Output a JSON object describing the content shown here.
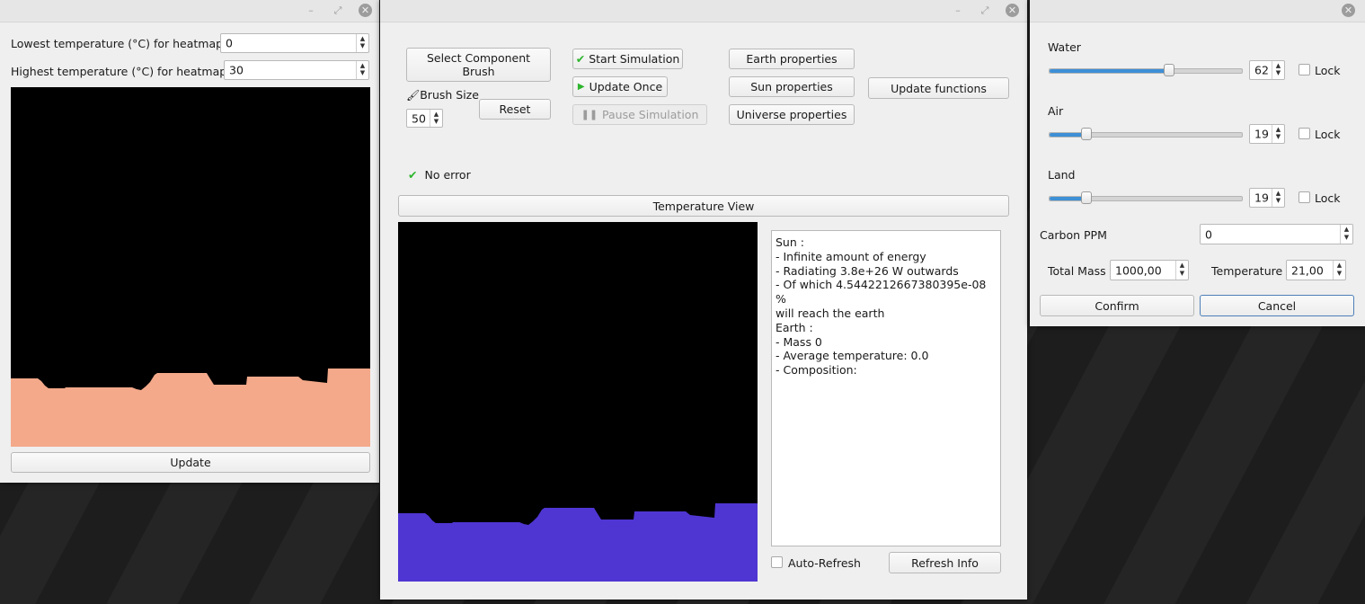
{
  "heatmap_window": {
    "low_label": "Lowest temperature (°C) for heatmap:",
    "low_value": "0",
    "high_label": "Highest temperature (°C) for heatmap:",
    "high_value": "30",
    "heatmap_color": "#f4a98a",
    "update_button": "Update"
  },
  "main_window": {
    "select_brush_button": "Select Component Brush",
    "brush_size_label": "Brush Size",
    "brush_size_value": "50",
    "reset_button": "Reset",
    "start_button": "Start Simulation",
    "update_once_button": "Update Once",
    "pause_button": "Pause Simulation",
    "earth_properties_button": "Earth properties",
    "sun_properties_button": "Sun properties",
    "universe_properties_button": "Universe properties",
    "update_functions_button": "Update functions",
    "status_text": "No error",
    "temperature_view_button": "Temperature View",
    "terrain_color": "#4f36d3",
    "info_text": "Sun :\n- Infinite amount of energy\n- Radiating 3.8e+26 W outwards\n- Of which 4.5442212667380395e-08 %\nwill reach the earth\nEarth :\n- Mass 0\n- Average temperature: 0.0\n- Composition:",
    "auto_refresh_label": "Auto-Refresh",
    "refresh_button": "Refresh Info"
  },
  "composition_window": {
    "water": {
      "label": "Water",
      "value": "62",
      "level": 62,
      "lock_label": "Lock"
    },
    "air": {
      "label": "Air",
      "value": "19",
      "level": 19,
      "lock_label": "Lock"
    },
    "land": {
      "label": "Land",
      "value": "19",
      "level": 19,
      "lock_label": "Lock"
    },
    "carbon_label": "Carbon PPM",
    "carbon_value": "0",
    "mass_label": "Total Mass",
    "mass_value": "1000,00",
    "temperature_label": "Temperature",
    "temperature_value": "21,00",
    "confirm_button": "Confirm",
    "cancel_button": "Cancel"
  }
}
